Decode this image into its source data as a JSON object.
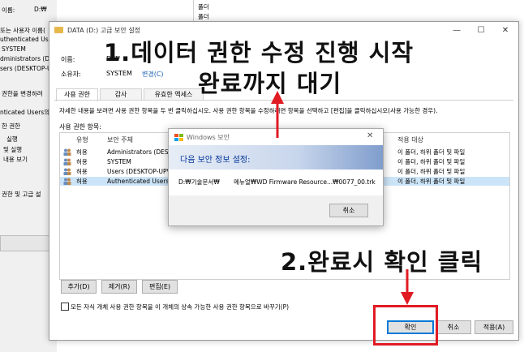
{
  "background_window": {
    "lines": [
      "이름:",
      "D:₩",
      "또는 사용자 이름(",
      "uthenticated Use",
      "SYSTEM",
      "dministrators (D",
      "sers (DESKTOP-U",
      "권한을 변경하려",
      "nticated Users의",
      "한 권한",
      "실행",
      "및 실행",
      "내용 보기",
      "권한 및 고급 설"
    ],
    "right_items": [
      "폴더",
      "폴더"
    ]
  },
  "main_window": {
    "title": "DATA (D:) 고급 보안 설정",
    "minimize": "—",
    "maximize": "☐",
    "close": "✕",
    "name_label": "이름:",
    "name_value": "D:₩",
    "owner_label": "소유자:",
    "owner_value": "SYSTEM",
    "owner_change": "변경(C)",
    "tabs": [
      "사용 권한",
      "감사",
      "유효한 액세스"
    ],
    "instructions": "자세한 내용을 보려면 사용 권한 항목을 두 번 클릭하십시오. 사용 권한 항목을 수정하려면 항목을 선택하고 [편집]을 클릭하십시오(사용 가능한 경우).",
    "list_label": "사용 권한 항목:",
    "columns": {
      "type": "유형",
      "principal": "보안 주체",
      "applies": "적용 대상"
    },
    "rows": [
      {
        "type": "허용",
        "principal": "Administrators (DESK",
        "applies": "이 폴더, 하위 폴더 및 파일"
      },
      {
        "type": "허용",
        "principal": "SYSTEM",
        "applies": "이 폴더, 하위 폴더 및 파일"
      },
      {
        "type": "허용",
        "principal": "Users (DESKTOP-UPV",
        "applies": "이 폴더, 하위 폴더 및 파일"
      },
      {
        "type": "허용",
        "principal": "Authenticated Users",
        "applies": "이 폴더, 하위 폴더 및 파일"
      }
    ],
    "add_button": "추가(D)",
    "remove_button": "제거(R)",
    "edit_button": "편집(E)",
    "inherit_checkbox_label": "모든 자식 개체 사용 권한 항목을 이 개체의 상속 가능한 사용 권한 항목으로 바꾸기(P)",
    "ok_button": "확인",
    "cancel_button": "취소",
    "apply_button": "적용(A)"
  },
  "popup": {
    "title": "Windows 보안",
    "heading": "다음 보안 정보 설정:",
    "path": "D:₩기술문서₩ 　　메뉴얼₩WD Firmware Resource...₩0077_00.trk",
    "close": "✕",
    "cancel_button": "취소"
  },
  "annotations": {
    "line1": "1.데이터 권한 수정 진행 시작",
    "line2": "완료까지 대기",
    "line3": "2.완료시 확인 클릭",
    "color": "#e01b24"
  }
}
